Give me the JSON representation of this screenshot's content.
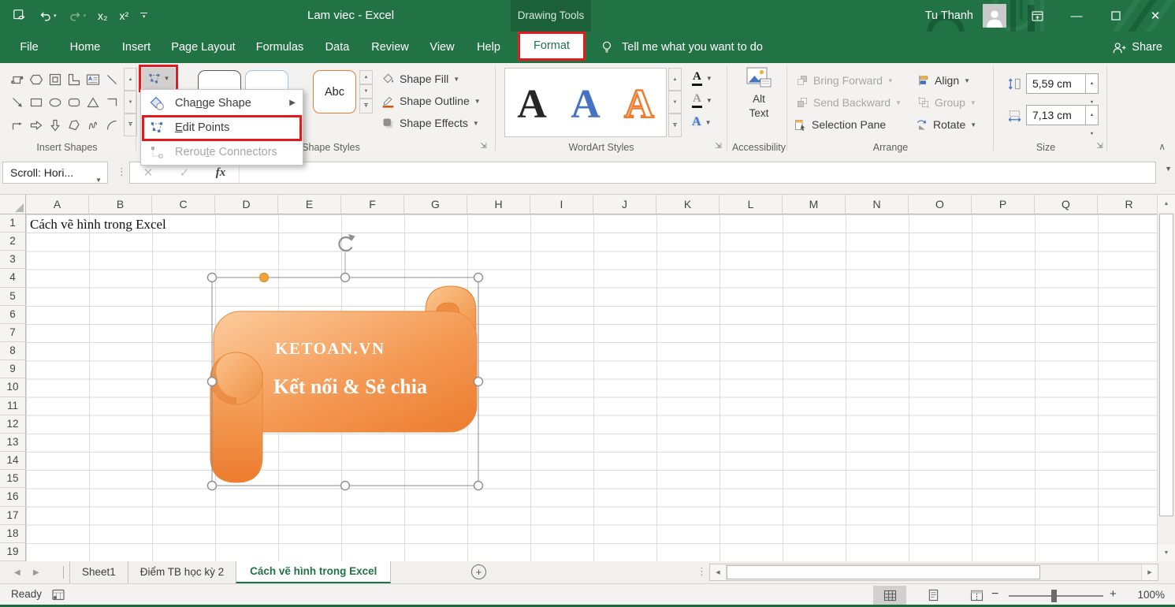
{
  "colors": {
    "excel_green": "#217346",
    "contextual_tab_bg": "#1b6038",
    "ribbon_bg": "#f3f2f1",
    "highlight_red": "#e21a20",
    "shape_orange": "#ED7D31",
    "shape_orange_light": "#FBC18A",
    "active_sheet_tab_green": "#217346"
  },
  "title_bar": {
    "title": "Lam viec - Excel",
    "contextual_tab": "Drawing Tools",
    "user_name": "Tu Thanh"
  },
  "quick_access": {
    "subscript": "x₂",
    "superscript": "x²"
  },
  "ribbon_tabs": [
    "File",
    "Home",
    "Insert",
    "Page Layout",
    "Formulas",
    "Data",
    "Review",
    "View",
    "Help",
    "Format"
  ],
  "active_tab": "Format",
  "tell_me_text": "Tell me what you want to do",
  "share_label": "Share",
  "ribbon": {
    "insert_shapes": {
      "label": "Insert Shapes"
    },
    "shape_styles": {
      "label": "Shape Styles",
      "preview_text": "Abc",
      "fill_label": "Shape Fill",
      "outline_label": "Shape Outline",
      "effects_label": "Shape Effects"
    },
    "wordart": {
      "label": "WordArt Styles",
      "letters": [
        "A",
        "A",
        "A"
      ]
    },
    "accessibility": {
      "label": "Accessibility",
      "alt_text_label": "Alt Text"
    },
    "arrange": {
      "label": "Arrange",
      "bring_forward": "Bring Forward",
      "send_backward": "Send Backward",
      "selection_pane": "Selection Pane",
      "align": "Align",
      "group": "Group",
      "rotate": "Rotate"
    },
    "size": {
      "label": "Size",
      "height_value": "5,59 cm",
      "width_value": "7,13 cm"
    }
  },
  "edit_shape_menu": {
    "items": [
      {
        "pre": "Cha",
        "key": "n",
        "post": "ge Shape",
        "enabled": true,
        "has_submenu": true
      },
      {
        "pre": "",
        "key": "E",
        "post": "dit Points",
        "enabled": true,
        "highlighted": true
      },
      {
        "pre": "Rerou",
        "key": "t",
        "post": "e Connectors",
        "enabled": false
      }
    ]
  },
  "formula_bar": {
    "name_box_value": "Scroll: Hori...",
    "fx_label": "fx",
    "formula_value": ""
  },
  "grid": {
    "columns": [
      "A",
      "B",
      "C",
      "D",
      "E",
      "F",
      "G",
      "H",
      "I",
      "J",
      "K",
      "L",
      "M",
      "N",
      "O",
      "P",
      "Q",
      "R"
    ],
    "rows": [
      "1",
      "2",
      "3",
      "4",
      "5",
      "6",
      "7",
      "8",
      "9",
      "10",
      "11",
      "12",
      "13",
      "14",
      "15",
      "16",
      "17",
      "18",
      "19"
    ],
    "cell_a1": "Cách vẽ hình trong Excel"
  },
  "shape": {
    "line1": "KETOAN.VN",
    "line2": "Kết nối & Sẻ chia"
  },
  "sheet_tabs": {
    "tabs": [
      "Sheet1",
      "Điểm TB học kỳ 2",
      "Cách vẽ hình trong Excel"
    ],
    "active_index": 2
  },
  "status_bar": {
    "mode": "Ready",
    "zoom_level": "100%"
  }
}
